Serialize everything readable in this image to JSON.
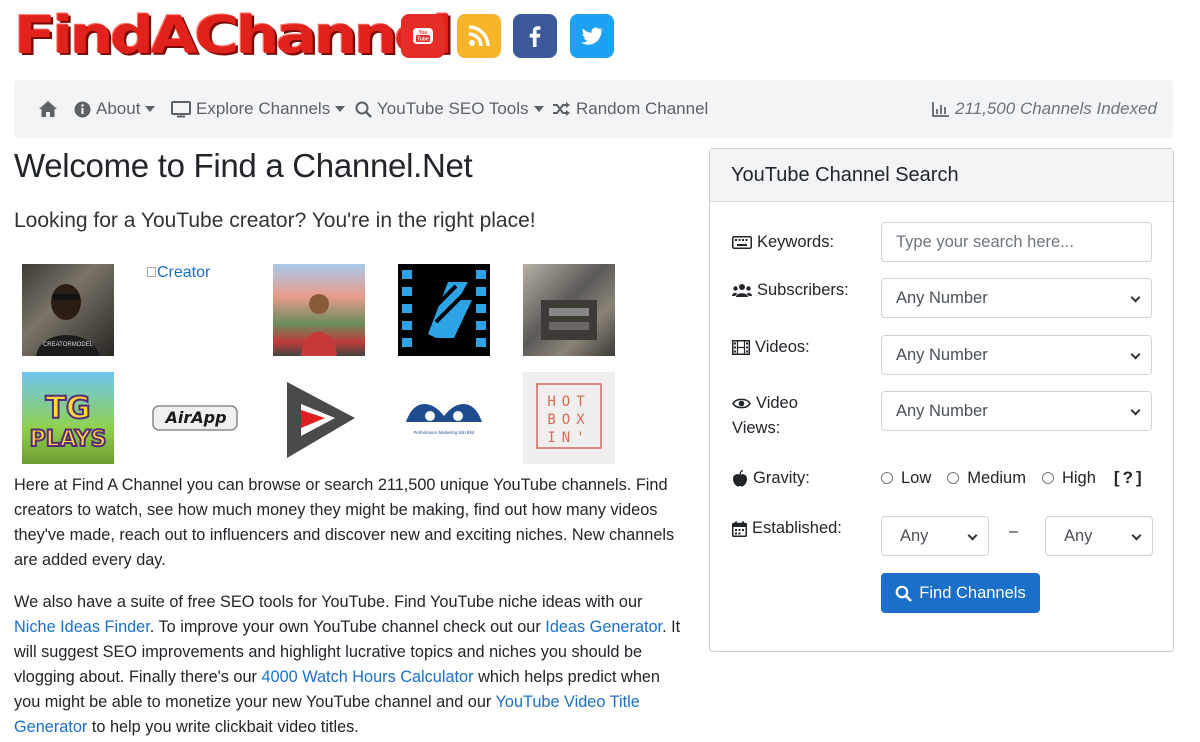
{
  "header": {
    "logo_text": "FindAChannel",
    "social": [
      "youtube-icon",
      "rss-icon",
      "facebook-icon",
      "twitter-icon"
    ],
    "social_colors": {
      "youtube": "#e52d27",
      "rss": "#f9b52a",
      "facebook": "#3b5998",
      "twitter": "#1da1f2"
    }
  },
  "nav": {
    "about": "About",
    "explore": "Explore Channels",
    "seo_tools": "YouTube SEO Tools",
    "random": "Random Channel",
    "indexed": "211,500 Channels Indexed"
  },
  "main": {
    "title": "Welcome to Find a Channel.Net",
    "lead": "Looking for a YouTube creator? You're in the right place!",
    "broken_image_alt": "Creator",
    "thumbs": [
      {
        "name": "creator-thumb-1",
        "label": "CREATORMODEL"
      },
      {
        "name": "creator-thumb-2",
        "label": "Creator"
      },
      {
        "name": "creator-thumb-3"
      },
      {
        "name": "creator-thumb-4"
      },
      {
        "name": "creator-thumb-5"
      },
      {
        "name": "creator-thumb-6",
        "label": "TG PLAYS"
      },
      {
        "name": "creator-thumb-7",
        "label": "AirApp"
      },
      {
        "name": "creator-thumb-8"
      },
      {
        "name": "creator-thumb-9",
        "label": "Performance Marketing Sdn Bhd"
      },
      {
        "name": "creator-thumb-10",
        "label": "HOT BOX IN"
      }
    ],
    "para1": "Here at Find A Channel you can browse or search 211,500 unique YouTube channels. Find creators to watch, see how much money they might be making, find out how many videos they've made, reach out to influencers and discover new and exciting niches. New channels are added every day.",
    "para2": {
      "t1": "We also have a suite of free SEO tools for YouTube. Find YouTube niche ideas with our ",
      "link1": "Niche Ideas Finder",
      "t2": ". To improve your own YouTube channel check out our ",
      "link2": "Ideas Generator",
      "t3": ". It will suggest SEO improvements and highlight lucrative topics and niches you should be vlogging about. Finally there's our ",
      "link3": "4000 Watch Hours Calculator",
      "t4": " which helps predict when you might be able to monetize your new YouTube channel and our ",
      "link4": "YouTube Video Title Generator",
      "t5": " to help you write clickbait video titles."
    }
  },
  "search": {
    "title": "YouTube Channel Search",
    "keywords_label": "Keywords:",
    "keywords_placeholder": "Type your search here...",
    "subscribers_label": "Subscribers:",
    "subscribers_value": "Any Number",
    "videos_label": "Videos:",
    "videos_value": "Any Number",
    "views_label_1": "Video",
    "views_label_2": "Views:",
    "views_value": "Any Number",
    "gravity_label": "Gravity:",
    "gravity_options": [
      "Low",
      "Medium",
      "High"
    ],
    "gravity_help": "[?]",
    "established_label": "Established:",
    "established_from": "Any",
    "established_to": "Any",
    "dash": "–",
    "button": "Find Channels",
    "accent": "#1a6fc9"
  }
}
